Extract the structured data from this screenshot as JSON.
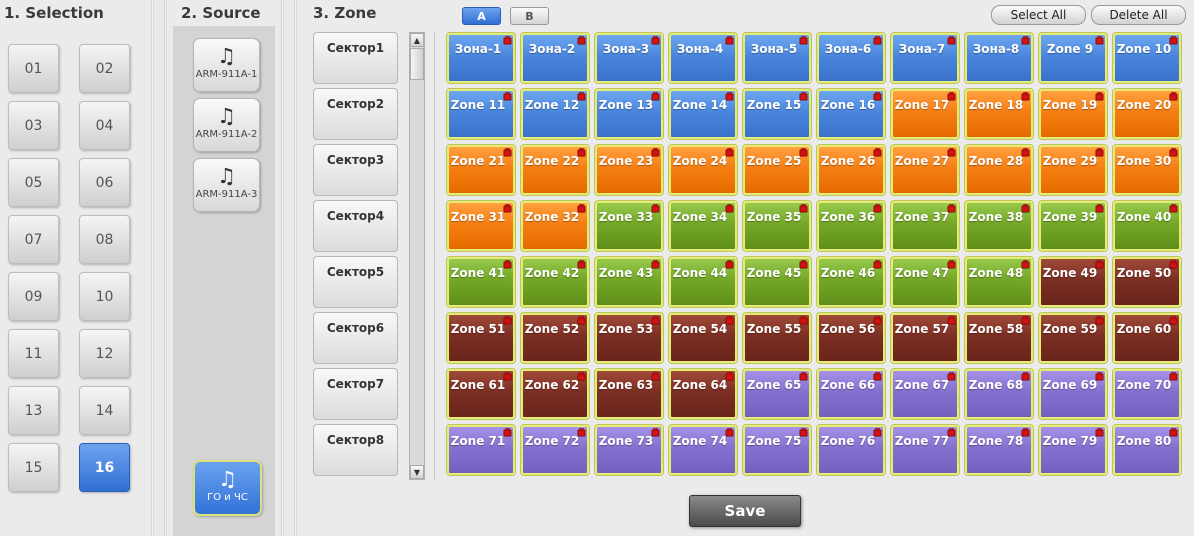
{
  "selection": {
    "title": "1. Selection",
    "items": [
      "01",
      "02",
      "03",
      "04",
      "05",
      "06",
      "07",
      "08",
      "09",
      "10",
      "11",
      "12",
      "13",
      "14",
      "15",
      "16"
    ],
    "active": "16"
  },
  "source": {
    "title": "2. Source",
    "items": [
      {
        "label": "ARM-911A-1",
        "icon": "music-note-icon"
      },
      {
        "label": "ARM-911A-2",
        "icon": "music-note-icon"
      },
      {
        "label": "ARM-911A-3",
        "icon": "music-note-icon"
      }
    ],
    "active_item": {
      "label": "ГО и ЧС",
      "icon": "music-note-icon"
    }
  },
  "zone": {
    "title": "3. Zone",
    "tab_a": "A",
    "tab_b": "B",
    "select_all": "Select All",
    "delete_all": "Delete All",
    "save": "Save",
    "sectors": [
      "Сектор1",
      "Сектор2",
      "Сектор3",
      "Сектор4",
      "Сектор5",
      "Сектор6",
      "Сектор7",
      "Сектор8"
    ],
    "colors": {
      "blue": "#4a86de",
      "orange": "#f57f13",
      "green": "#74a727",
      "brown": "#7d2f23",
      "purple": "#8470cf",
      "selected_border": "#e4ec74"
    },
    "rows": [
      [
        {
          "label": "Зона-1",
          "color": "blue"
        },
        {
          "label": "Зона-2",
          "color": "blue"
        },
        {
          "label": "Зона-3",
          "color": "blue"
        },
        {
          "label": "Зона-4",
          "color": "blue"
        },
        {
          "label": "Зона-5",
          "color": "blue"
        },
        {
          "label": "Зона-6",
          "color": "blue"
        },
        {
          "label": "Зона-7",
          "color": "blue"
        },
        {
          "label": "Зона-8",
          "color": "blue"
        },
        {
          "label": "Zone 9",
          "color": "blue"
        },
        {
          "label": "Zone 10",
          "color": "blue"
        }
      ],
      [
        {
          "label": "Zone 11",
          "color": "blue"
        },
        {
          "label": "Zone 12",
          "color": "blue"
        },
        {
          "label": "Zone 13",
          "color": "blue"
        },
        {
          "label": "Zone 14",
          "color": "blue"
        },
        {
          "label": "Zone 15",
          "color": "blue"
        },
        {
          "label": "Zone 16",
          "color": "blue"
        },
        {
          "label": "Zone 17",
          "color": "orange"
        },
        {
          "label": "Zone 18",
          "color": "orange"
        },
        {
          "label": "Zone 19",
          "color": "orange"
        },
        {
          "label": "Zone 20",
          "color": "orange"
        }
      ],
      [
        {
          "label": "Zone 21",
          "color": "orange"
        },
        {
          "label": "Zone 22",
          "color": "orange"
        },
        {
          "label": "Zone 23",
          "color": "orange"
        },
        {
          "label": "Zone 24",
          "color": "orange"
        },
        {
          "label": "Zone 25",
          "color": "orange"
        },
        {
          "label": "Zone 26",
          "color": "orange"
        },
        {
          "label": "Zone 27",
          "color": "orange"
        },
        {
          "label": "Zone 28",
          "color": "orange"
        },
        {
          "label": "Zone 29",
          "color": "orange"
        },
        {
          "label": "Zone 30",
          "color": "orange"
        }
      ],
      [
        {
          "label": "Zone 31",
          "color": "orange"
        },
        {
          "label": "Zone 32",
          "color": "orange"
        },
        {
          "label": "Zone 33",
          "color": "green"
        },
        {
          "label": "Zone 34",
          "color": "green"
        },
        {
          "label": "Zone 35",
          "color": "green"
        },
        {
          "label": "Zone 36",
          "color": "green"
        },
        {
          "label": "Zone 37",
          "color": "green"
        },
        {
          "label": "Zone 38",
          "color": "green"
        },
        {
          "label": "Zone 39",
          "color": "green"
        },
        {
          "label": "Zone 40",
          "color": "green"
        }
      ],
      [
        {
          "label": "Zone 41",
          "color": "green"
        },
        {
          "label": "Zone 42",
          "color": "green"
        },
        {
          "label": "Zone 43",
          "color": "green"
        },
        {
          "label": "Zone 44",
          "color": "green"
        },
        {
          "label": "Zone 45",
          "color": "green"
        },
        {
          "label": "Zone 46",
          "color": "green"
        },
        {
          "label": "Zone 47",
          "color": "green"
        },
        {
          "label": "Zone 48",
          "color": "green"
        },
        {
          "label": "Zone 49",
          "color": "brown"
        },
        {
          "label": "Zone 50",
          "color": "brown"
        }
      ],
      [
        {
          "label": "Zone 51",
          "color": "brown"
        },
        {
          "label": "Zone 52",
          "color": "brown"
        },
        {
          "label": "Zone 53",
          "color": "brown"
        },
        {
          "label": "Zone 54",
          "color": "brown"
        },
        {
          "label": "Zone 55",
          "color": "brown"
        },
        {
          "label": "Zone 56",
          "color": "brown"
        },
        {
          "label": "Zone 57",
          "color": "brown"
        },
        {
          "label": "Zone 58",
          "color": "brown"
        },
        {
          "label": "Zone 59",
          "color": "brown"
        },
        {
          "label": "Zone 60",
          "color": "brown"
        }
      ],
      [
        {
          "label": "Zone 61",
          "color": "brown"
        },
        {
          "label": "Zone 62",
          "color": "brown"
        },
        {
          "label": "Zone 63",
          "color": "brown"
        },
        {
          "label": "Zone 64",
          "color": "brown"
        },
        {
          "label": "Zone 65",
          "color": "purple"
        },
        {
          "label": "Zone 66",
          "color": "purple"
        },
        {
          "label": "Zone 67",
          "color": "purple"
        },
        {
          "label": "Zone 68",
          "color": "purple"
        },
        {
          "label": "Zone 69",
          "color": "purple"
        },
        {
          "label": "Zone 70",
          "color": "purple"
        }
      ],
      [
        {
          "label": "Zone 71",
          "color": "purple"
        },
        {
          "label": "Zone 72",
          "color": "purple"
        },
        {
          "label": "Zone 73",
          "color": "purple"
        },
        {
          "label": "Zone 74",
          "color": "purple"
        },
        {
          "label": "Zone 75",
          "color": "purple"
        },
        {
          "label": "Zone 76",
          "color": "purple"
        },
        {
          "label": "Zone 77",
          "color": "purple"
        },
        {
          "label": "Zone 78",
          "color": "purple"
        },
        {
          "label": "Zone 79",
          "color": "purple"
        },
        {
          "label": "Zone 80",
          "color": "purple"
        }
      ]
    ]
  }
}
